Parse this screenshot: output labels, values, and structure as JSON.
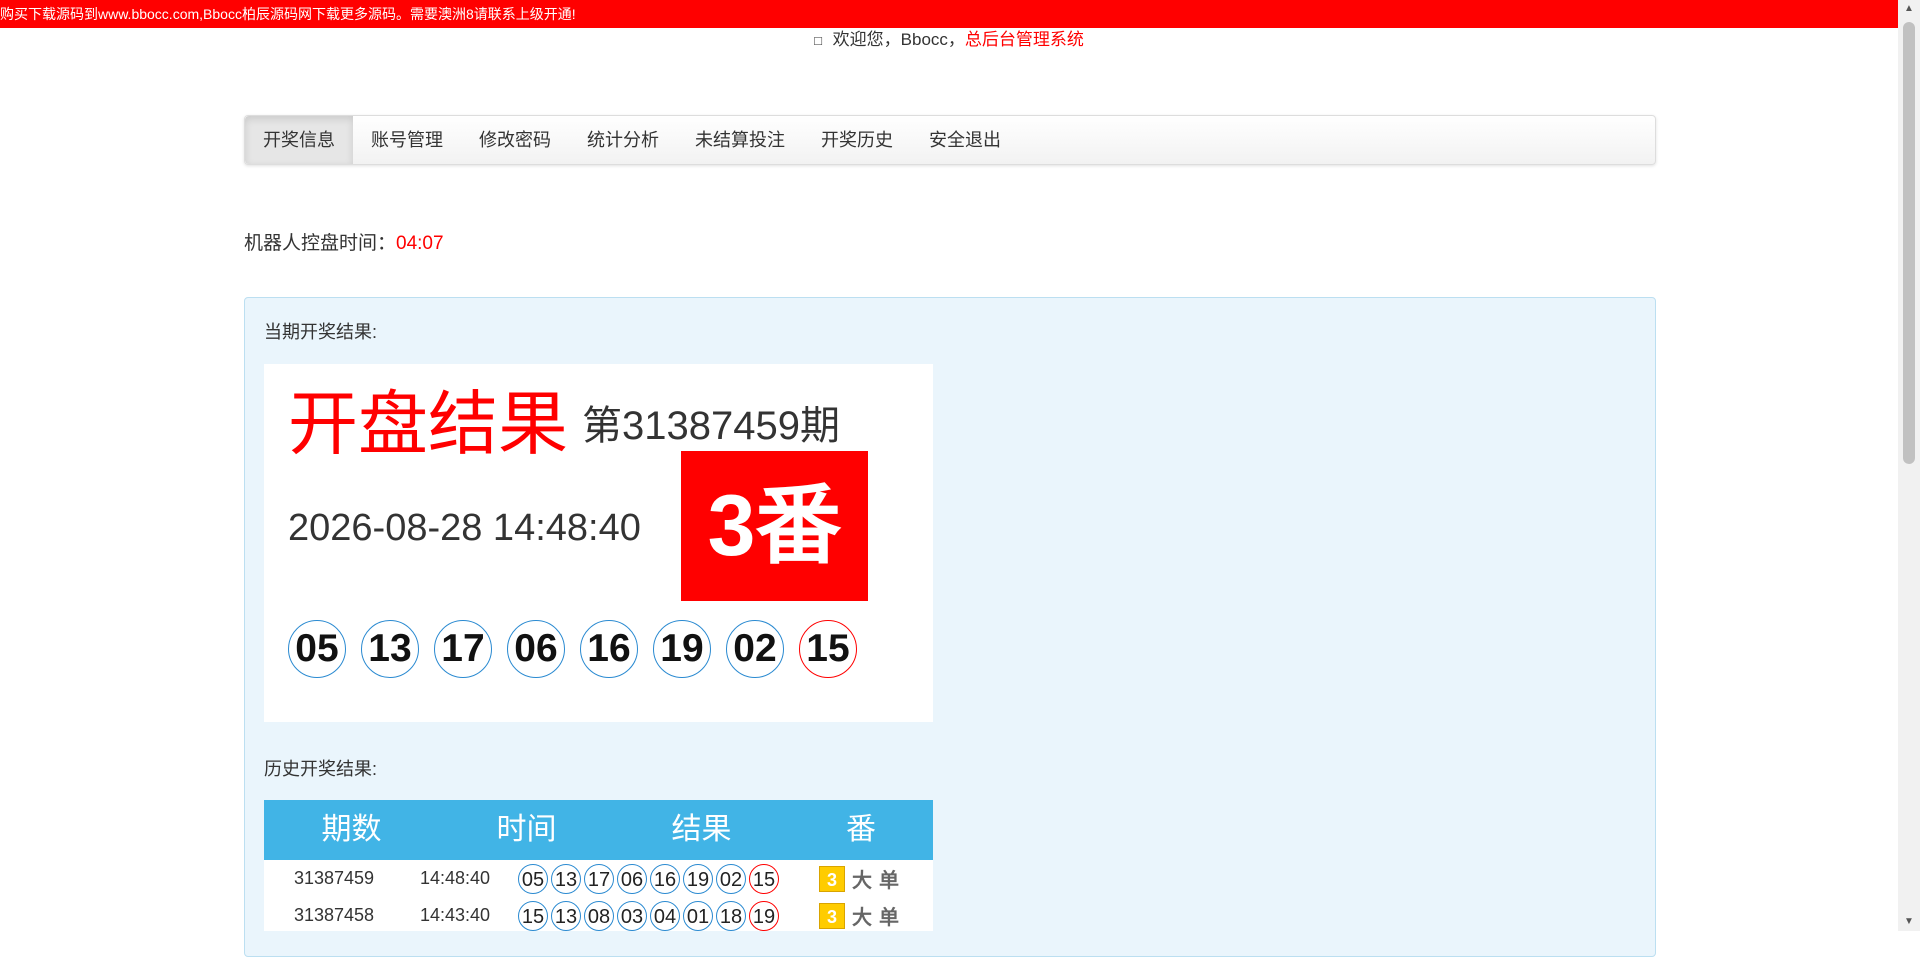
{
  "notice": "购买下载源码到www.bbocc.com,Bbocc柏辰源码网下载更多源码。需要澳洲8请联系上级开通!",
  "welcome": {
    "icon": "user-icon",
    "text": "欢迎您，Bbocc，",
    "system": "总后台管理系统"
  },
  "nav": {
    "items": [
      "开奖信息",
      "账号管理",
      "修改密码",
      "统计分析",
      "未结算投注",
      "开奖历史",
      "安全退出"
    ],
    "active": "开奖信息"
  },
  "robot": {
    "label": "机器人控盘时间：",
    "value": "04:07"
  },
  "current": {
    "label": "当期开奖结果:",
    "title": "开盘结果",
    "period": "第31387459期",
    "datetime": "2026-08-28 14:48:40",
    "fan": "3番",
    "balls": [
      "05",
      "13",
      "17",
      "06",
      "16",
      "19",
      "02",
      "15"
    ]
  },
  "history": {
    "label": "历史开奖结果:",
    "headers": [
      "期数",
      "时间",
      "结果",
      "番"
    ],
    "rows": [
      {
        "period": "31387459",
        "time": "14:48:40",
        "balls": [
          "05",
          "13",
          "17",
          "06",
          "16",
          "19",
          "02",
          "15"
        ],
        "fan": "3",
        "size": "大",
        "parity": "单"
      },
      {
        "period": "31387458",
        "time": "14:43:40",
        "balls": [
          "15",
          "13",
          "08",
          "03",
          "04",
          "01",
          "18",
          "19"
        ],
        "fan": "3",
        "size": "大",
        "parity": "单"
      }
    ]
  },
  "colors": {
    "accent_red": "#ff0000",
    "ball_border": "#2a8ad1",
    "table_header": "#41b4e6",
    "panel_bg": "#eaf5fc",
    "fan_badge": "#ffcc00"
  }
}
